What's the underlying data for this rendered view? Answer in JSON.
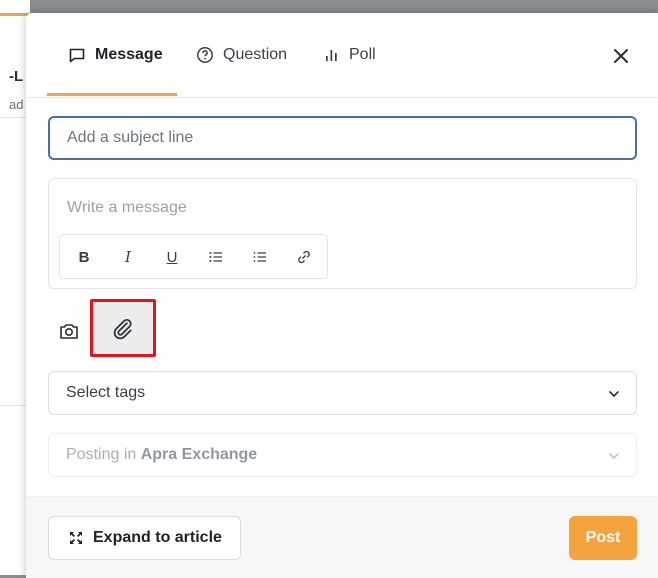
{
  "background_page": {
    "fragment_1": "-L",
    "fragment_2": "ad"
  },
  "tabs": [
    {
      "label": "Message",
      "icon": "speech-bubble-icon",
      "active": true
    },
    {
      "label": "Question",
      "icon": "question-circle-icon",
      "active": false
    },
    {
      "label": "Poll",
      "icon": "bar-chart-icon",
      "active": false
    }
  ],
  "close_icon": "close-icon",
  "subject": {
    "placeholder": "Add a subject line",
    "value": ""
  },
  "message": {
    "placeholder": "Write a message",
    "toolbar": [
      {
        "name": "bold",
        "glyph": "B"
      },
      {
        "name": "italic",
        "glyph": "I"
      },
      {
        "name": "underline",
        "glyph": "U"
      },
      {
        "name": "numbered-list",
        "glyph": "≡"
      },
      {
        "name": "bulleted-list",
        "glyph": "≡"
      },
      {
        "name": "link",
        "glyph": "🔗"
      }
    ]
  },
  "attachments": {
    "camera_icon": "camera-icon",
    "paperclip_icon": "paperclip-icon"
  },
  "tags": {
    "placeholder": "Select tags"
  },
  "posting": {
    "prefix": "Posting in",
    "community": "Apra Exchange"
  },
  "footer": {
    "expand_label": "Expand to article",
    "post_label": "Post"
  },
  "colors": {
    "accent": "#f5a33c",
    "focus_border": "#4a6ea8",
    "highlight_box": "#e0161c"
  }
}
